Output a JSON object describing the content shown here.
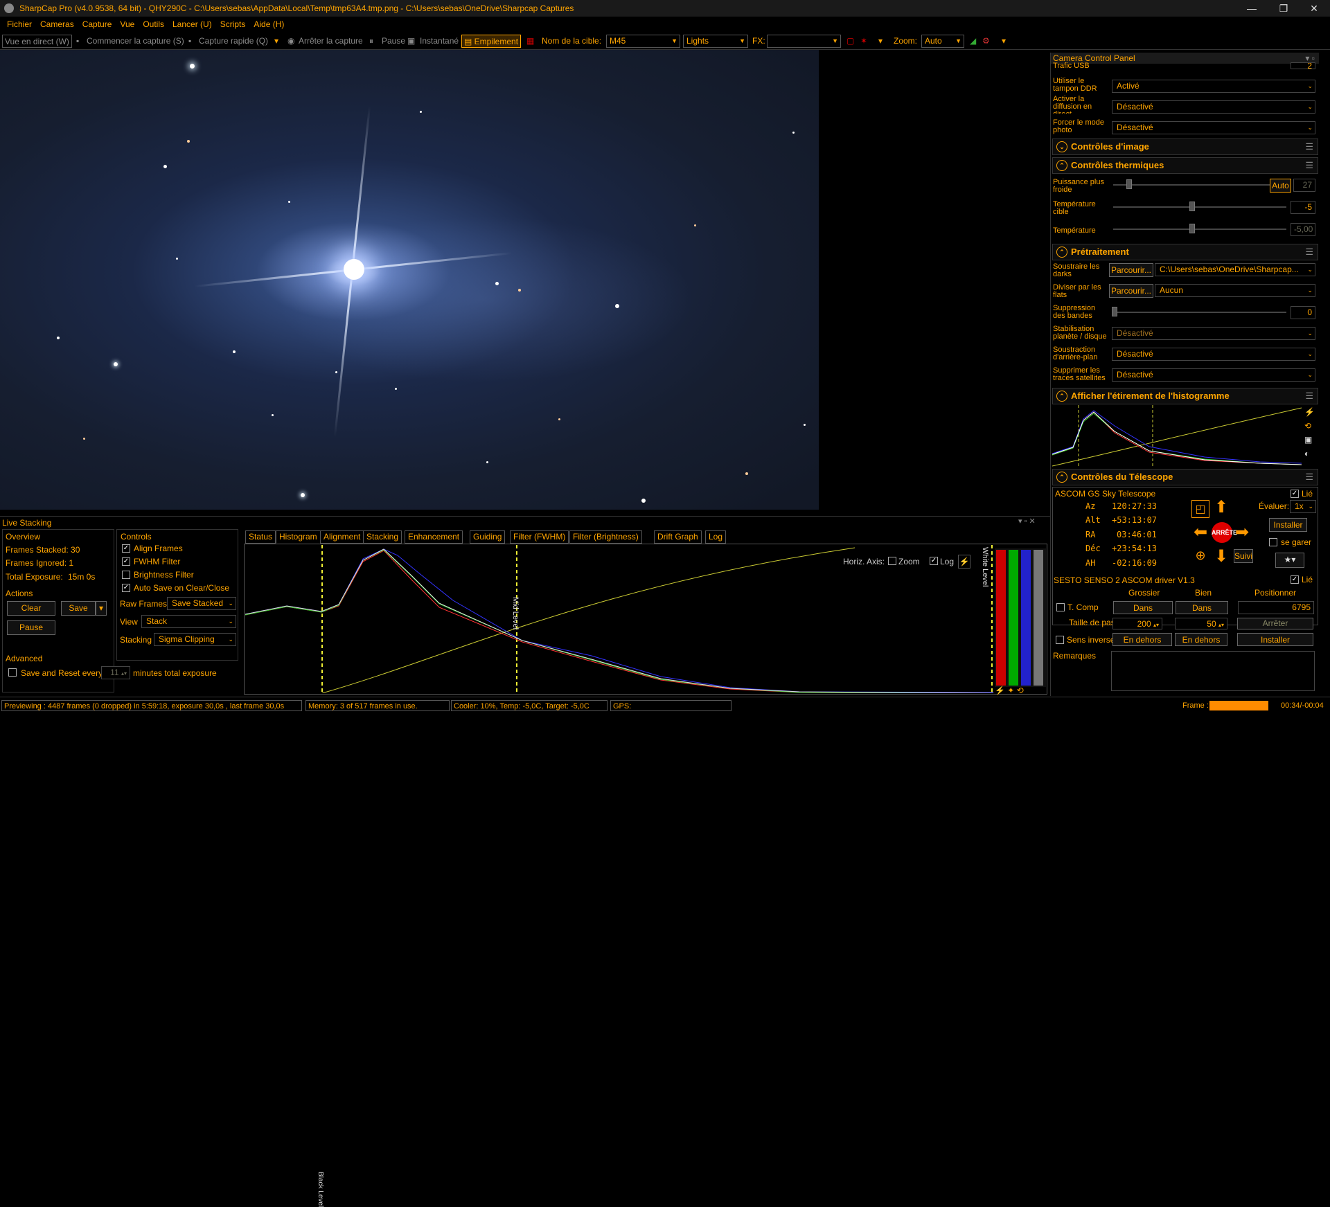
{
  "window": {
    "title": "SharpCap Pro (v4.0.9538, 64 bit) - QHY290C - C:\\Users\\sebas\\AppData\\Local\\Temp\\tmp63A4.tmp.png - C:\\Users\\sebas\\OneDrive\\Sharpcap Captures",
    "min": "—",
    "max": "❐",
    "close": "✕"
  },
  "menu": [
    "Fichier",
    "Cameras",
    "Capture",
    "Vue",
    "Outils",
    "Lancer (U)",
    "Scripts",
    "Aide (H)"
  ],
  "toolbar": {
    "live_view": "Vue en direct (W)",
    "start_capture": "Commencer la capture (S)",
    "quick_capture": "Capture rapide (Q)",
    "stop_capture": "Arrêter la capture",
    "pause": "Pause",
    "snapshot": "Instantané",
    "stacking": "Empilement",
    "target_label": "Nom de la cible:",
    "target_value": "M45",
    "frame_type": "Lights",
    "fx_label": "FX:",
    "fx_value": "",
    "zoom_label": "Zoom:",
    "zoom_value": "Auto"
  },
  "panel": {
    "title": "Camera Control Panel",
    "usb_label": "Trafic USB",
    "usb_value": "2",
    "ddr_label": "Utiliser le tampon DDR",
    "ddr_value": "Activé",
    "stream_label": "Activer la diffusion en direct",
    "stream_value": "Désactivé",
    "photo_label": "Forcer le mode photo",
    "photo_value": "Désactivé",
    "image_controls": "Contrôles d'image",
    "thermal": {
      "title": "Contrôles thermiques",
      "cooler_label": "Puissance plus froide",
      "cooler_auto": "Auto",
      "cooler_value": "27",
      "target_label": "Température cible",
      "target_value": "-5",
      "temp_label": "Température",
      "temp_value": "-5,00"
    },
    "preprocessing": {
      "title": "Prétraitement",
      "darks_label": "Soustraire les darks",
      "browse": "Parcourir...",
      "darks_path": "C:\\Users\\sebas\\OneDrive\\Sharpcap...",
      "flats_label": "Diviser par les flats",
      "flats_value": "Aucun",
      "banding_label": "Suppression des bandes",
      "banding_value": "0",
      "stab_label": "Stabilisation planète / disque",
      "stab_value": "Désactivé",
      "bg_label": "Soustraction d'arrière-plan",
      "bg_value": "Désactivé",
      "sat_label": "Supprimer les traces satellites",
      "sat_value": "Désactivé"
    },
    "histogram_title": "Afficher l'étirement de l'histogramme",
    "telescope": {
      "title": "Contrôles du Télescope",
      "driver": "ASCOM GS Sky Telescope",
      "linked": "Lié",
      "az_label": "Az",
      "az": "120:27:33",
      "alt_label": "Alt",
      "alt": "+53:13:07",
      "ra_label": "RA",
      "ra": "03:46:01",
      "dec_label": "Déc",
      "dec": "+23:54:13",
      "ah_label": "AH",
      "ah": "-02:16:09",
      "rate_label": "Évaluer:",
      "rate": "1x",
      "stop": "ARRÊTE",
      "install": "Installer",
      "park": "se garer",
      "track": "Suivi"
    },
    "focuser": {
      "driver": "SESTO SENSO 2 ASCOM driver V1.3",
      "linked": "Lié",
      "coarse": "Grossier",
      "fine": "Bien",
      "position": "Positionner",
      "tcomp": "T. Comp",
      "in1": "Dans",
      "in2": "Dans",
      "pos_value": "6795",
      "step_label": "Taille de pas",
      "step_coarse": "200",
      "step_fine": "50",
      "stop": "Arrêter",
      "reverse": "Sens inverse",
      "out1": "En dehors",
      "out2": "En dehors",
      "install": "Installer",
      "notes": "Remarques"
    }
  },
  "stacking": {
    "title": "Live Stacking",
    "overview": "Overview",
    "frames_stacked": "Frames Stacked: 30",
    "frames_ignored": "Frames Ignored: 1",
    "total_exposure_label": "Total Exposure:",
    "total_exposure": "15m 0s",
    "actions": "Actions",
    "clear": "Clear",
    "save": "Save",
    "pause": "Pause",
    "advanced": "Advanced",
    "save_reset": "Save and Reset every",
    "save_reset_value": "11",
    "save_reset_unit": "minutes total exposure",
    "controls": "Controls",
    "align": "Align Frames",
    "fwhm": "FWHM Filter",
    "brightness": "Brightness Filter",
    "autosave": "Auto Save on Clear/Close",
    "raw_frames_label": "Raw Frames",
    "raw_frames": "Save Stacked",
    "view_label": "View",
    "view": "Stack",
    "stacking_label": "Stacking",
    "stacking_mode": "Sigma Clipping",
    "tabs": [
      "Status",
      "Histogram",
      "Alignment",
      "Stacking",
      "Enhancement",
      "Guiding",
      "Filter (FWHM)",
      "Filter (Brightness)",
      "Drift Graph",
      "Log"
    ],
    "horiz_axis": "Horiz. Axis:",
    "zoom": "Zoom",
    "log": "Log",
    "black_level": "Black Level",
    "mid_level": "Mid Level",
    "white_level": "White Level"
  },
  "status": {
    "preview": "Previewing : 4487 frames (0 dropped) in 5:59:18, exposure 30,0s , last frame 30,0s",
    "memory": "Memory: 3 of 517 frames in use.",
    "cooler": "Cooler: 10%, Temp: -5,0C, Target: -5,0C",
    "gps": "GPS:",
    "frame_label": "Frame :",
    "frame_time": "00:34/-00:04",
    "frame_progress": 0.85
  },
  "colors": {
    "accent": "#ffa500",
    "stop_red": "#e00000"
  }
}
